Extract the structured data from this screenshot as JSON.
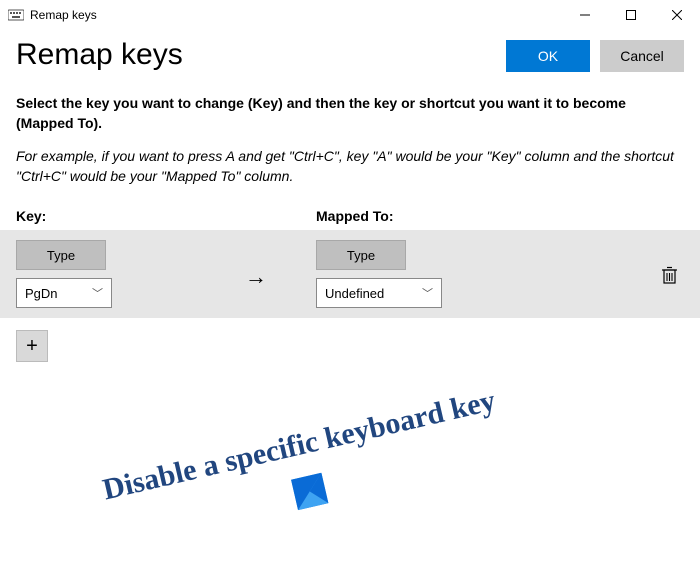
{
  "titlebar": {
    "title": "Remap keys"
  },
  "header": {
    "page_title": "Remap keys",
    "ok_label": "OK",
    "cancel_label": "Cancel"
  },
  "instructions": {
    "main": "Select the key you want to change (Key) and then the key or shortcut you want it to become (Mapped To).",
    "example": "For example, if you want to press A and get \"Ctrl+C\", key \"A\" would be your \"Key\" column and the shortcut \"Ctrl+C\" would be your \"Mapped To\" column."
  },
  "columns": {
    "key_label": "Key:",
    "mapped_label": "Mapped To:"
  },
  "row": {
    "type_label": "Type",
    "key_value": "PgDn",
    "arrow_glyph": "→",
    "mapped_value": "Undefined"
  },
  "add_button_glyph": "+",
  "watermark": {
    "text": "Disable a specific keyboard key"
  }
}
